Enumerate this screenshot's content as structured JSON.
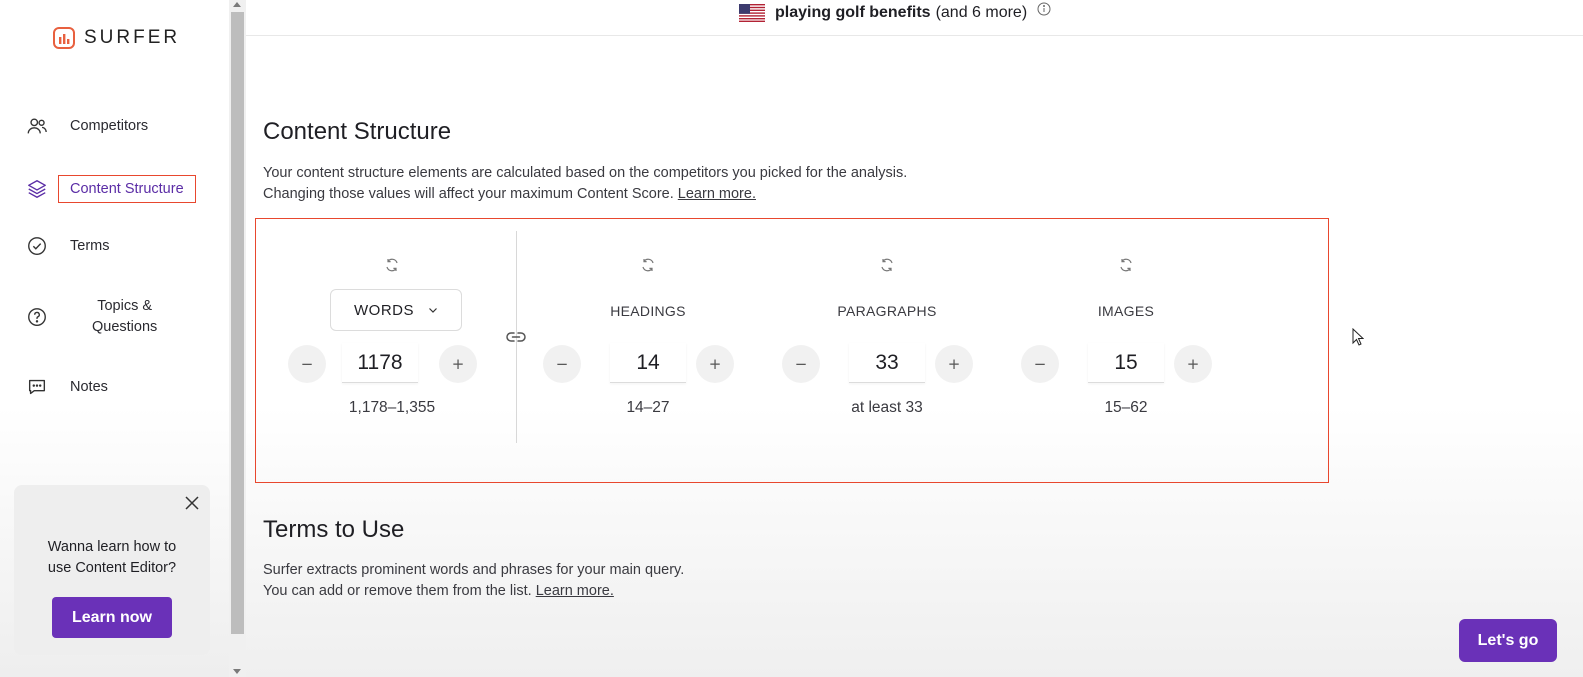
{
  "brand": {
    "name": "SURFER"
  },
  "sidebar": {
    "items": [
      {
        "label": "Competitors",
        "icon": "users-icon"
      },
      {
        "label": "Content Structure",
        "icon": "layers-icon",
        "active": true
      },
      {
        "label": "Terms",
        "icon": "check-circle-icon"
      },
      {
        "label_line1": "Topics &",
        "label_line2": "Questions",
        "icon": "question-circle-icon"
      },
      {
        "label": "Notes",
        "icon": "chat-bubble-icon"
      }
    ],
    "promo": {
      "text_line1": "Wanna learn how to",
      "text_line2": "use Content Editor?",
      "button": "Learn now"
    }
  },
  "header": {
    "query": "playing golf benefits",
    "more": "(and 6 more)",
    "flag": "us-flag-icon"
  },
  "content_structure": {
    "title": "Content Structure",
    "desc_line1": "Your content structure elements are calculated based on the competitors you picked for the analysis.",
    "desc_line2": "Changing those values will affect your maximum Content Score.",
    "learn_more": "Learn more.",
    "metrics": {
      "words": {
        "label": "WORDS",
        "value": "1178",
        "range": "1,178–1,355"
      },
      "headings": {
        "label": "HEADINGS",
        "value": "14",
        "range": "14–27"
      },
      "paragraphs": {
        "label": "PARAGRAPHS",
        "value": "33",
        "range": "at least 33"
      },
      "images": {
        "label": "IMAGES",
        "value": "15",
        "range": "15–62"
      }
    }
  },
  "terms": {
    "title": "Terms to Use",
    "desc_line1": "Surfer extracts prominent words and phrases for your main query.",
    "desc_line2": "You can add or remove them from the list.",
    "learn_more": "Learn more."
  },
  "cta": {
    "label": "Let's go"
  },
  "colors": {
    "accent": "#6a31b8",
    "highlight": "#e8472e",
    "brand": "#e8603f"
  }
}
